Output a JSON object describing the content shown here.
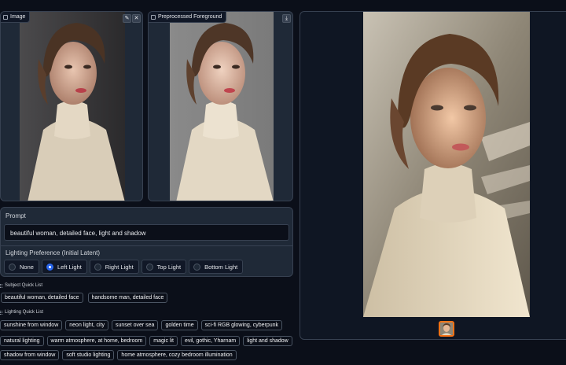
{
  "input_panel": {
    "label": "Image"
  },
  "foreground_panel": {
    "label": "Preprocessed Foreground"
  },
  "prompt": {
    "label": "Prompt",
    "value": "beautiful woman, detailed face, light and shadow"
  },
  "lighting_preference": {
    "label": "Lighting Preference (Initial Latent)",
    "options": [
      "None",
      "Left Light",
      "Right Light",
      "Top Light",
      "Bottom Light"
    ],
    "selected": "Left Light"
  },
  "subject_quick_list": {
    "label": "Subject Quick List",
    "items": [
      "beautiful woman, detailed face",
      "handsome man, detailed face"
    ]
  },
  "lighting_quick_list": {
    "label": "Lighting Quick List",
    "rows": [
      [
        "sunshine from window",
        "neon light, city",
        "sunset over sea",
        "golden time",
        "sci-fi RGB glowing, cyberpunk"
      ],
      [
        "natural lighting",
        "warm atmosphere, at home, bedroom",
        "magic lit",
        "evil, gothic, Yharnam",
        "light and shadow"
      ],
      [
        "shadow from window",
        "soft studio lighting",
        "home atmosphere, cozy bedroom illumination"
      ]
    ]
  }
}
